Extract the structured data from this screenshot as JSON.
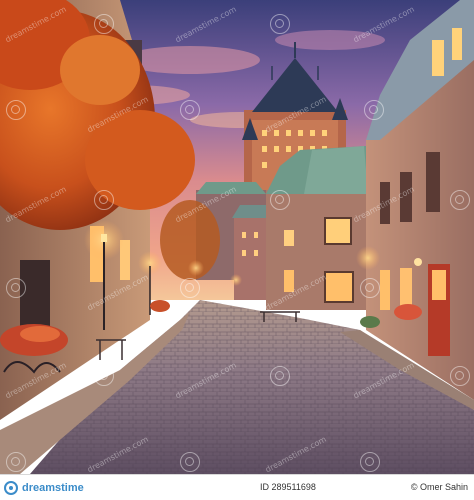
{
  "image": {
    "description_icon": "photo",
    "palette": {
      "sky_top": "#3b3f7a",
      "sky_mid": "#8b6aa8",
      "sky_glow": "#f0a48a",
      "stone_warm": "#c99a78",
      "cobble": "#7a6a7c",
      "foliage": "#d35a1e",
      "lamp": "#ffc870",
      "roof_green": "#6f9a8a",
      "castle_roof": "#2d3a56"
    }
  },
  "watermark": {
    "text": "dreamstime.com"
  },
  "footer": {
    "brand": "dreamstime",
    "id_text": "ID 289511698",
    "credit_text": "© Omer Sahin"
  }
}
